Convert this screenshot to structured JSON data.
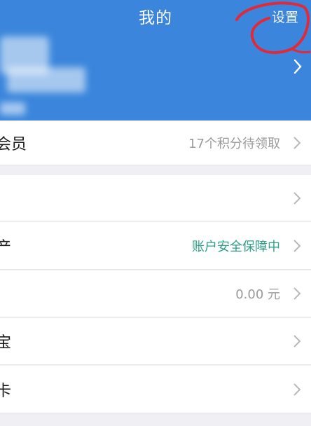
{
  "header": {
    "title": "我的",
    "settings_label": "设置",
    "bg_color": "#3b86dc"
  },
  "rows": [
    {
      "label": "会员",
      "value": "17个积分待领取"
    },
    {
      "label": "",
      "value": ""
    },
    {
      "label": "产",
      "value": "账户安全保障中",
      "value_color": "#2f9f88"
    },
    {
      "label": "",
      "value": "0.00 元"
    },
    {
      "label": "宝",
      "value": ""
    },
    {
      "label": "卡",
      "value": ""
    }
  ],
  "icons": {
    "row_chevron": "chevron-right-icon",
    "header_chevron": "chevron-right-icon"
  }
}
